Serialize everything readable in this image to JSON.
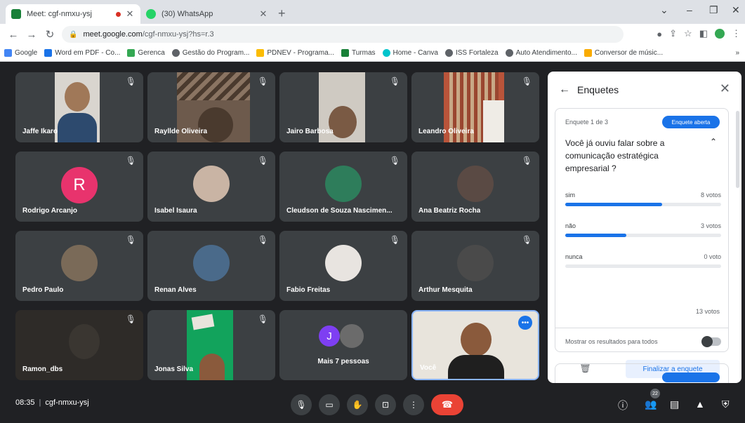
{
  "browser": {
    "tabs": [
      {
        "title": "Meet: cgf-nmxu-ysj",
        "icon_color": "#188038",
        "active": true,
        "recording_icon": "red-dot-icon"
      },
      {
        "title": "(30) WhatsApp",
        "icon_color": "#25d366",
        "active": false
      }
    ],
    "new_tab_glyph": "+",
    "url_host": "meet.google.com",
    "url_path": "/cgf-nmxu-ysj?hs=r.3",
    "bookmarks": [
      {
        "label": "Google",
        "icon_color": "#4285f4"
      },
      {
        "label": "Word em PDF - Co...",
        "icon_color": "#1a73e8"
      },
      {
        "label": "Gerenca",
        "icon_color": "#34a853"
      },
      {
        "label": "Gestão do Program...",
        "icon_color": "#5f6368"
      },
      {
        "label": "PDNEV - Programa...",
        "icon_color": "#fbbc04"
      },
      {
        "label": "Turmas",
        "icon_color": "#188038"
      },
      {
        "label": "Home - Canva",
        "icon_color": "#00c4cc"
      },
      {
        "label": "ISS Fortaleza",
        "icon_color": "#5f6368"
      },
      {
        "label": "Auto Atendimento...",
        "icon_color": "#5f6368"
      },
      {
        "label": "Conversor de músic...",
        "icon_color": "#f9ab00"
      }
    ]
  },
  "participants": [
    {
      "name": "Jaffe Ikaro",
      "type": "photo",
      "color": "#2d4a6e",
      "bg": "#d9d5cf"
    },
    {
      "name": "Rayllde Oliveira",
      "type": "photo",
      "color": "#4a3a2e",
      "bg": "#6d5a4c"
    },
    {
      "name": "Jairo Barbosa",
      "type": "photo",
      "color": "#7a5a44",
      "bg": "#cfcac2"
    },
    {
      "name": "Leandro Oliveira",
      "type": "photo",
      "color": "#c8a886",
      "bg": "#b9543a"
    },
    {
      "name": "Rodrigo Arcanjo",
      "type": "letter",
      "letter": "R"
    },
    {
      "name": "Isabel Isaura",
      "type": "avatar",
      "color": "#c9b4a4"
    },
    {
      "name": "Cleudson de Souza Nascimen...",
      "type": "avatar",
      "color": "#2e7d5b"
    },
    {
      "name": "Ana Beatriz Rocha",
      "type": "avatar",
      "color": "#5a4a44"
    },
    {
      "name": "Pedro Paulo",
      "type": "avatar",
      "color": "#7a6a58"
    },
    {
      "name": "Renan Alves",
      "type": "avatar",
      "color": "#4a6a8a"
    },
    {
      "name": "Fabio Freitas",
      "type": "avatar",
      "color": "#e8e4e0"
    },
    {
      "name": "Arthur Mesquita",
      "type": "avatar",
      "color": "#4a4a4a"
    },
    {
      "name": "Ramon_dbs",
      "type": "photo",
      "color": "#3a3631",
      "bg": "#2e2b28"
    },
    {
      "name": "Jonas Silva",
      "type": "photo",
      "color": "#1e7a4a",
      "bg": "#12a35c"
    },
    {
      "name": "Mais 7 pessoas",
      "type": "more",
      "letter": "J"
    },
    {
      "name": "Você",
      "type": "self"
    }
  ],
  "poll_panel": {
    "title": "Enquetes",
    "poll_count": "Enquete 1 de 3",
    "status_badge": "Enquete aberta",
    "question": "Você já ouviu falar sobre a comunicação estratégica empresarial ?",
    "options": [
      {
        "label": "sim",
        "votes": "8 votos",
        "fraction": 0.62
      },
      {
        "label": "não",
        "votes": "3 votos",
        "fraction": 0.39
      },
      {
        "label": "nunca",
        "votes": "0 voto",
        "fraction": 0
      }
    ],
    "total": "13 votos",
    "show_results_label": "Mostrar os resultados para todos",
    "finish_label": "Finalizar a enquete"
  },
  "bottom_bar": {
    "time": "08:35",
    "meeting_code": "cgf-nmxu-ysj",
    "people_count": "22"
  }
}
